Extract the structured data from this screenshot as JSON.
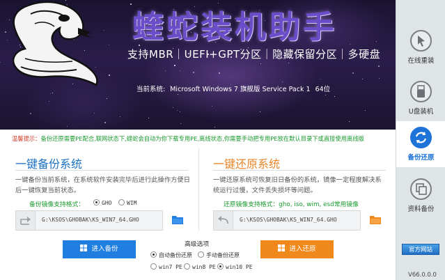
{
  "banner": {
    "title": "蝰蛇装机助手",
    "tagline": "支持MBR｜UEFI+GPT分区｜隐藏保留分区｜多硬盘",
    "sys_label": "当前系统:",
    "sys_value": "Microsoft Windows 7 旗舰版 Service Pack 1",
    "sys_bits": "64位"
  },
  "sidebar": {
    "items": [
      {
        "label": "在线重装",
        "icon": "cursor-icon"
      },
      {
        "label": "U盘装机",
        "icon": "usb-icon"
      },
      {
        "label": "备份还原",
        "icon": "sync-icon",
        "active": true
      },
      {
        "label": "资料备份",
        "icon": "copy-icon"
      }
    ],
    "official_label": "官方网站",
    "version": "V66.0.0.0"
  },
  "tip": {
    "prefix": "温馨提示：",
    "text": "备份还原需要PE配合,联网状态下,蝰蛇会自动为你下载专用PE,离线状态,你需要手动把专用PE放在默认目录下或直接使用离线版"
  },
  "backup": {
    "title": "一键备份系统",
    "desc": "一键备份当前系统，在系统软件安装完毕后进行此操作方便日后一键恢复当前状态。",
    "format_label": "备份镜像支持格式：",
    "formats": [
      "GHO",
      "WIM"
    ],
    "selected_format": "GHO",
    "path": "G:\\KSOS\\GHOBAK\\KS_WIN7_64.GHO",
    "button": "进入备份"
  },
  "restore": {
    "title": "一键还原系统",
    "desc": "一键还原系统可恢复旧日备份的系统，镜像一定程度解决系统运行过慢，文件丢失损坏等问题。",
    "format_label": "还原镜像支持格式：gho, iso, wim, esd常用镜像",
    "path": "G:\\KSOS\\GHOBAK\\KS_WIN7_64.GHO",
    "button": "进入还原"
  },
  "advanced": {
    "title": "高级选项",
    "mode_options": [
      "自动备份还原",
      "手动备份还原"
    ],
    "selected_mode": "自动备份还原",
    "pe_options": [
      "win7 PE",
      "win8 PE",
      "win10 PE"
    ],
    "selected_pe": "win10 PE"
  },
  "colors": {
    "accent_blue": "#1f7ee0",
    "accent_orange": "#f0891b",
    "tip_green": "#1a9a2e",
    "title_purple": "#6a4dc9"
  }
}
